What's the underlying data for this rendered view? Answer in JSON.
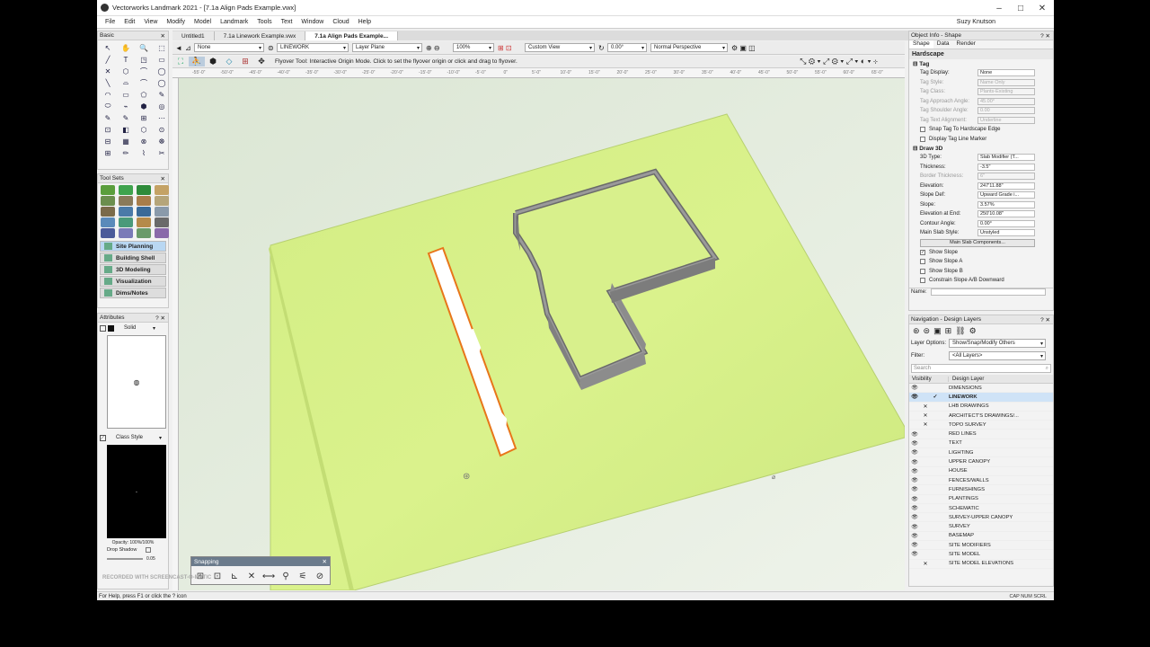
{
  "window": {
    "title": "Vectorworks Landmark 2021 - [7.1a Align Pads Example.vwx]",
    "minimize": "–",
    "maximize": "□",
    "close": "✕"
  },
  "menu": {
    "items": [
      "File",
      "Edit",
      "View",
      "Modify",
      "Model",
      "Landmark",
      "Tools",
      "Text",
      "Window",
      "Cloud",
      "Help"
    ],
    "user": "Suzy Knutson"
  },
  "basic_palette": {
    "title": "Basic",
    "tools": [
      "↖",
      "✋",
      "🔍",
      "⬚",
      "╱",
      "T",
      "◳",
      "▭",
      "✕",
      "⬡",
      "⌒",
      "◯",
      "╲",
      "⌓",
      "⌒",
      "◯",
      "◠",
      "▭",
      "⬠",
      "✎",
      "⬭",
      "⌁",
      "⬢",
      "◎",
      "✎",
      "✎",
      "⊞",
      "⋯",
      "⊡",
      "◧",
      "⬡",
      "⊙",
      "⊟",
      "▦",
      "⊗",
      "☸",
      "⊞",
      "✏",
      "⌇",
      "✂"
    ]
  },
  "toolsets_palette": {
    "title": "Tool Sets",
    "colors": [
      "#5a9e3c",
      "#3fa34d",
      "#2e8b3a",
      "#c4a265",
      "#6b8e4e",
      "#8a7a5a",
      "#a87d4a",
      "#b5a57a",
      "#7a6a4a",
      "#4a7aa8",
      "#3a6a98",
      "#8a9aaa",
      "#5a8aba",
      "#4a9a7a",
      "#b58a4a",
      "#6a6a6a",
      "#4a5a9a",
      "#7a7ab8",
      "#6a9a6a",
      "#8a6aaa"
    ],
    "sets": [
      "Site Planning",
      "Building Shell",
      "3D Modeling",
      "Visualization",
      "Dims/Notes"
    ],
    "active": "Site Planning"
  },
  "attributes_palette": {
    "title": "Attributes",
    "fill_label": "Solid",
    "pen_label": "Class Style",
    "opacity": "Opacity: 100%/100%",
    "drop_shadow": "Drop Shadow",
    "slider_value": "0.05"
  },
  "tabs": [
    "Untitled1",
    "7.1a Linework Example.vwx",
    "7.1a Align Pads Example..."
  ],
  "active_tab": 2,
  "view_bar": {
    "class": "None",
    "layer": "LINEWORK",
    "plane": "Layer Plane",
    "zoom": "100%",
    "view": "Custom View",
    "rotation": "0.00°",
    "render": "Normal Perspective"
  },
  "mode_bar": {
    "hint": "Flyover Tool: Interactive Origin Mode. Click to set the flyover origin or click and drag to flyover."
  },
  "ruler": {
    "ticks": [
      "-55'-0\"",
      "-50'-0\"",
      "-45'-0\"",
      "-40'-0\"",
      "-35'-0\"",
      "-30'-0\"",
      "-25'-0\"",
      "-20'-0\"",
      "-15'-0\"",
      "-10'-0\"",
      "-5'-0\"",
      "0\"",
      "5'-0\"",
      "10'-0\"",
      "15'-0\"",
      "20'-0\"",
      "25'-0\"",
      "30'-0\"",
      "35'-0\"",
      "40'-0\"",
      "45'-0\"",
      "50'-0\"",
      "55'-0\"",
      "60'-0\"",
      "65'-0\""
    ]
  },
  "object_info": {
    "title": "Object Info - Shape",
    "tabs": [
      "Shape",
      "Data",
      "Render"
    ],
    "object_type": "Hardscape",
    "tag_section": "Tag",
    "tag_rows": [
      {
        "label": "Tag Display:",
        "value": "None",
        "disabled": false
      },
      {
        "label": "Tag Style:",
        "value": "Name Only",
        "disabled": true
      },
      {
        "label": "Tag Class:",
        "value": "Plants-Existing",
        "disabled": true
      },
      {
        "label": "Tag Approach Angle:",
        "value": "45.00°",
        "disabled": true
      },
      {
        "label": "Tag Shoulder Angle:",
        "value": "0.00",
        "disabled": true
      },
      {
        "label": "Tag Text Alignment:",
        "value": "Underline",
        "disabled": true
      }
    ],
    "tag_checks": [
      {
        "label": "Snap Tag To Hardscape Edge",
        "checked": false
      },
      {
        "label": "Display Tag Line Marker",
        "checked": false
      }
    ],
    "draw3d_section": "Draw 3D",
    "draw3d_rows": [
      {
        "label": "3D Type:",
        "value": "Slab Modifier (T...",
        "disabled": false
      },
      {
        "label": "Thickness:",
        "value": "-3.5\"",
        "disabled": false
      },
      {
        "label": "Border Thickness:",
        "value": "6\"",
        "disabled": true
      },
      {
        "label": "Elevation:",
        "value": "247'11.88\"",
        "disabled": false
      },
      {
        "label": "Slope Def:",
        "value": "Upward Grade i...",
        "disabled": false
      },
      {
        "label": "Slope:",
        "value": "3.57%",
        "disabled": false
      },
      {
        "label": "Elevation at End:",
        "value": "250'10.08\"",
        "disabled": false
      },
      {
        "label": "Contour Angle:",
        "value": "0.00°",
        "disabled": false
      },
      {
        "label": "Main Slab Style:",
        "value": "Unstyled",
        "disabled": false
      }
    ],
    "components_button": "Main Slab Components...",
    "slope_checks": [
      {
        "label": "Show Slope",
        "checked": true
      },
      {
        "label": "Show Slope A",
        "checked": false
      },
      {
        "label": "Show Slope B",
        "checked": false
      },
      {
        "label": "Constrain Slope A/B Downward",
        "checked": false
      }
    ],
    "name_label": "Name:"
  },
  "navigation": {
    "title": "Navigation - Design Layers",
    "layer_options_label": "Layer Options:",
    "layer_options_value": "Show/Snap/Modify Others",
    "filter_label": "Filter:",
    "filter_value": "<All Layers>",
    "search_placeholder": "Search",
    "col_visibility": "Visibility",
    "col_layer": "Design Layer",
    "layers": [
      {
        "name": "DIMENSIONS",
        "vis": "👁",
        "x": "",
        "ck": ""
      },
      {
        "name": "LINEWORK",
        "vis": "👁",
        "x": "",
        "ck": "✓",
        "active": true
      },
      {
        "name": "LHB DRAWINGS",
        "vis": "",
        "x": "✕",
        "ck": ""
      },
      {
        "name": "ARCHITECT'S DRAWINGS/...",
        "vis": "",
        "x": "✕",
        "ck": ""
      },
      {
        "name": "TOPO SURVEY",
        "vis": "",
        "x": "✕",
        "ck": ""
      },
      {
        "name": "RED LINES",
        "vis": "👁",
        "x": "",
        "ck": ""
      },
      {
        "name": "TEXT",
        "vis": "👁",
        "x": "",
        "ck": ""
      },
      {
        "name": "LIGHTING",
        "vis": "👁",
        "x": "",
        "ck": ""
      },
      {
        "name": "UPPER CANOPY",
        "vis": "👁",
        "x": "",
        "ck": ""
      },
      {
        "name": "HOUSE",
        "vis": "👁",
        "x": "",
        "ck": ""
      },
      {
        "name": "FENCES/WALLS",
        "vis": "👁",
        "x": "",
        "ck": ""
      },
      {
        "name": "FURNISHINGS",
        "vis": "👁",
        "x": "",
        "ck": ""
      },
      {
        "name": "PLANTINGS",
        "vis": "👁",
        "x": "",
        "ck": ""
      },
      {
        "name": "SCHEMATIC",
        "vis": "👁",
        "x": "",
        "ck": ""
      },
      {
        "name": "SURVEY-UPPER CANOPY",
        "vis": "👁",
        "x": "",
        "ck": ""
      },
      {
        "name": "SURVEY",
        "vis": "👁",
        "x": "",
        "ck": ""
      },
      {
        "name": "BASEMAP",
        "vis": "👁",
        "x": "",
        "ck": ""
      },
      {
        "name": "SITE MODIFIERS",
        "vis": "👁",
        "x": "",
        "ck": ""
      },
      {
        "name": "SITE MODEL",
        "vis": "👁",
        "x": "",
        "ck": ""
      },
      {
        "name": "SITE MODEL ELEVATIONS",
        "vis": "",
        "x": "✕",
        "ck": ""
      }
    ]
  },
  "snapping": {
    "title": "Snapping",
    "icons": [
      "⊞",
      "⊡",
      "⊾",
      "✕",
      "⟷",
      "⚲",
      "⚟",
      "⊘"
    ]
  },
  "status": {
    "help": "For Help, press F1 or click the ? icon",
    "indicators": "CAP  NUM  SCRL",
    "watermark": "RECORDED WITH SCREENCAST-O-MATIC"
  },
  "colors": {
    "site_green": "#d6f08a",
    "canvas_bg": "#e6efe1",
    "pad_orange": "#e8761a",
    "wall_gray": "#8a8a8a"
  }
}
